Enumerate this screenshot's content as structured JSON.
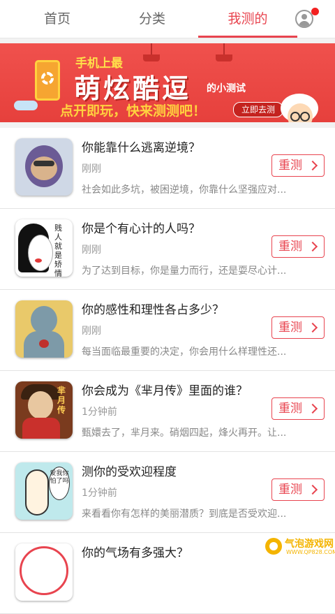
{
  "tabs": [
    {
      "label": "首页"
    },
    {
      "label": "分类"
    },
    {
      "label": "我测的"
    }
  ],
  "banner": {
    "line1": "手机上最",
    "line2": "萌炫酷逗",
    "line2_suffix": "的小测试",
    "line3": "点开即玩，快来测测吧！",
    "button": "立即去测"
  },
  "items": [
    {
      "title": "你能靠什么逃离逆境？",
      "time": "刚刚",
      "desc": "社会如此多坑，被困逆境，你靠什么坚强应对...",
      "action": "重测"
    },
    {
      "title": "你是个有心计的人吗？",
      "time": "刚刚",
      "desc": "为了达到目标，你是量力而行，还是耍尽心计...",
      "action": "重测"
    },
    {
      "title": "你的感性和理性各占多少？",
      "time": "刚刚",
      "desc": "每当面临最重要的决定，你会用什么样理性还...",
      "action": "重测"
    },
    {
      "title": "你会成为《芈月传》里面的谁？",
      "time": "1分钟前",
      "desc": "甄嬛去了，芈月来。硝烟四起，烽火再开。让...",
      "action": "重测"
    },
    {
      "title": "测你的受欢迎程度",
      "time": "1分钟前",
      "desc": "来看看你有怎样的美丽潜质？到底是否受欢迎...",
      "action": "重测"
    },
    {
      "title": "你的气场有多强大？",
      "time": "",
      "desc": "",
      "action": ""
    }
  ],
  "thumb_texts": {
    "t2": "贱人就是矫情",
    "t4": "芈月传",
    "t5": "爱我你怕了吗"
  },
  "watermark": {
    "name": "气泡游戏网",
    "url": "WWW.QP828.COM"
  },
  "colors": {
    "accent": "#e8444f",
    "banner": "#ee4a46"
  }
}
